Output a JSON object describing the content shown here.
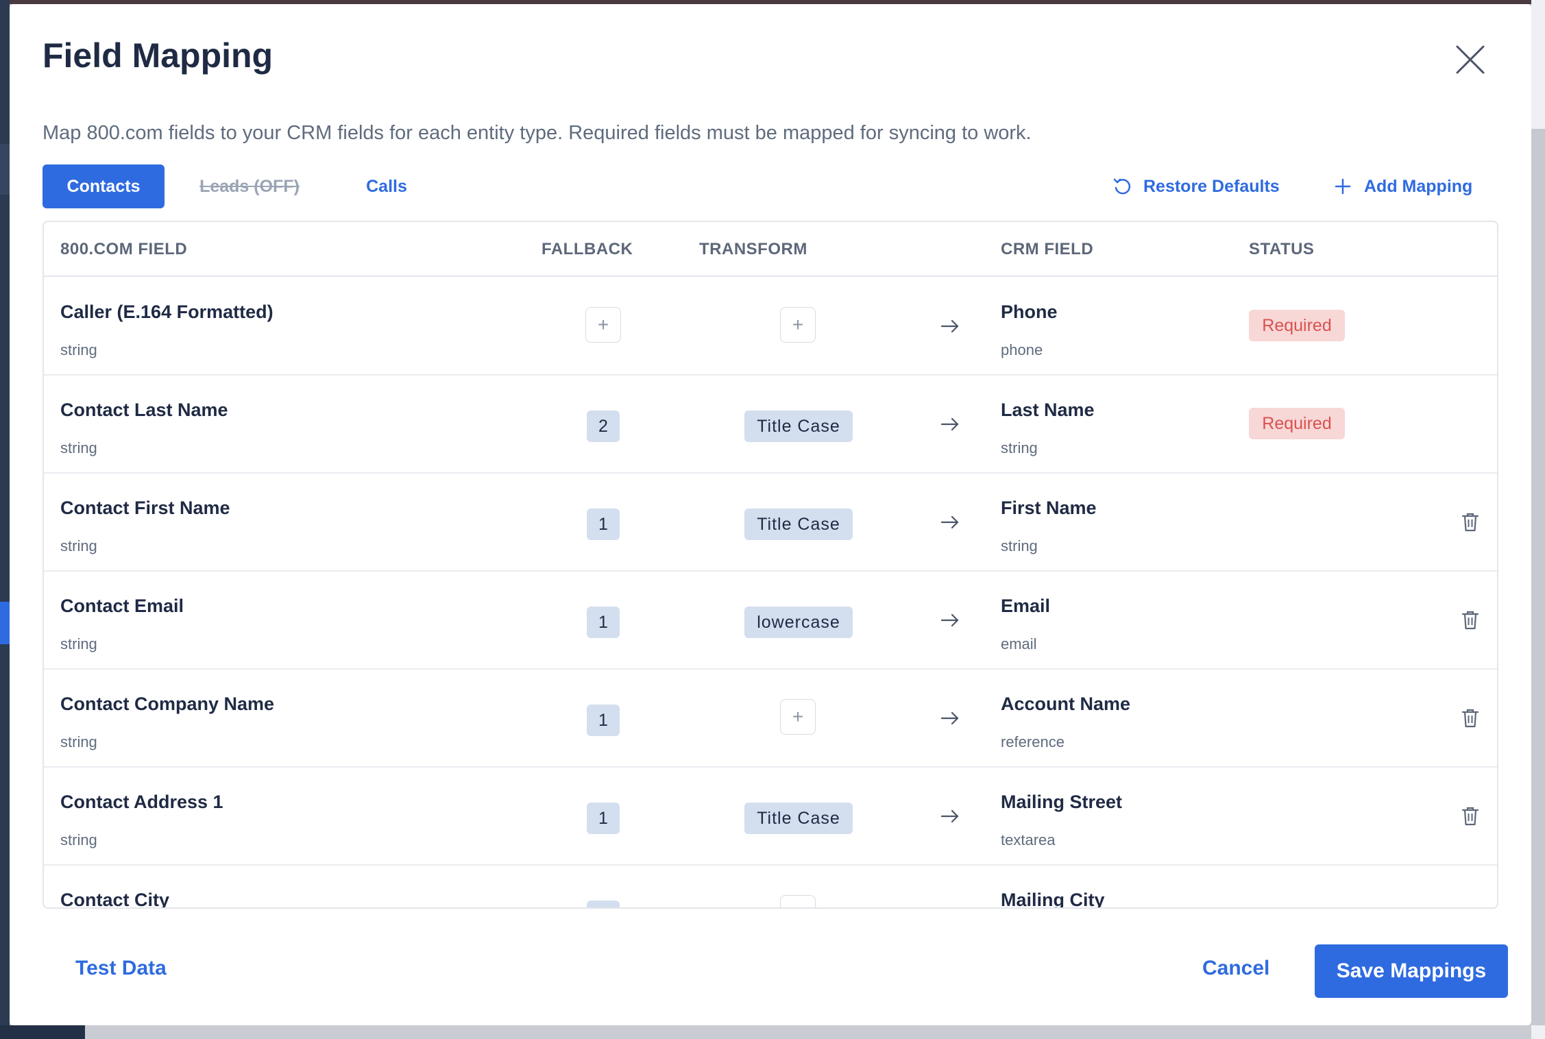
{
  "modal": {
    "title": "Field Mapping",
    "description": "Map 800.com fields to your CRM fields for each entity type. Required fields must be mapped for syncing to work."
  },
  "tabs": [
    {
      "label": "Contacts",
      "state": "active"
    },
    {
      "label": "Leads (OFF)",
      "state": "disabled"
    },
    {
      "label": "Calls",
      "state": "inactive"
    }
  ],
  "actions": {
    "restore_label": "Restore Defaults",
    "add_label": "Add Mapping"
  },
  "table": {
    "headers": [
      "800.COM FIELD",
      "FALLBACK",
      "TRANSFORM",
      "CRM FIELD",
      "STATUS"
    ],
    "rows": [
      {
        "field": "Caller (E.164 Formatted)",
        "field_type": "string",
        "fallback": "",
        "transform": "",
        "crm_field": "Phone",
        "crm_type": "phone",
        "status": "Required"
      },
      {
        "field": "Contact Last Name",
        "field_type": "string",
        "fallback": "2",
        "transform": "Title Case",
        "crm_field": "Last Name",
        "crm_type": "string",
        "status": "Required"
      },
      {
        "field": "Contact First Name",
        "field_type": "string",
        "fallback": "1",
        "transform": "Title Case",
        "crm_field": "First Name",
        "crm_type": "string",
        "status": ""
      },
      {
        "field": "Contact Email",
        "field_type": "string",
        "fallback": "1",
        "transform": "lowercase",
        "crm_field": "Email",
        "crm_type": "email",
        "status": ""
      },
      {
        "field": "Contact Company Name",
        "field_type": "string",
        "fallback": "1",
        "transform": "",
        "crm_field": "Account Name",
        "crm_type": "reference",
        "status": ""
      },
      {
        "field": "Contact Address 1",
        "field_type": "string",
        "fallback": "1",
        "transform": "Title Case",
        "crm_field": "Mailing Street",
        "crm_type": "textarea",
        "status": ""
      },
      {
        "field": "Contact City",
        "field_type": "",
        "fallback": "",
        "transform": "",
        "crm_field": "Mailing City",
        "crm_type": "",
        "status": ""
      }
    ]
  },
  "footer": {
    "test_data_label": "Test Data",
    "cancel_label": "Cancel",
    "save_label": "Save Mappings"
  },
  "icons": {
    "close": "close-icon",
    "restore": "undo-icon",
    "add": "plus-icon",
    "arrow": "arrow-right-icon",
    "delete": "trash-icon"
  },
  "colors": {
    "accent": "#2f6be0",
    "required_bg": "#f8d7d7",
    "required_text": "#d9534f",
    "badge_bg": "#d3deef"
  }
}
